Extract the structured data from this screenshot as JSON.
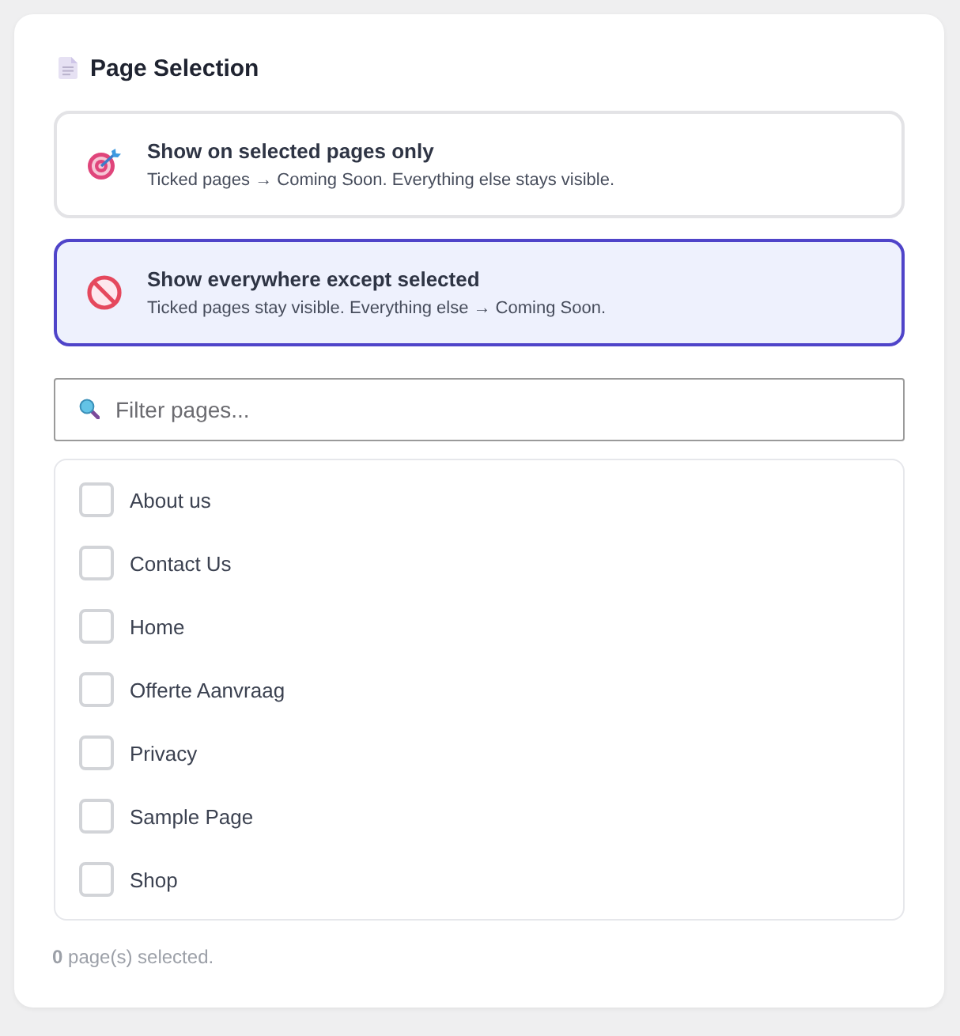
{
  "section": {
    "title": "Page Selection"
  },
  "modes": [
    {
      "kind": "include",
      "title": "Show on selected pages only",
      "description": "Ticked pages → Coming Soon. Everything else stays visible.",
      "selected": false
    },
    {
      "kind": "exclude",
      "title": "Show everywhere except selected",
      "description": "Ticked pages stay visible. Everything else → Coming Soon.",
      "selected": true
    }
  ],
  "filter": {
    "placeholder": "Filter pages..."
  },
  "pages": [
    {
      "label": "About us",
      "checked": false
    },
    {
      "label": "Contact Us",
      "checked": false
    },
    {
      "label": "Home",
      "checked": false
    },
    {
      "label": "Offerte Aanvraag",
      "checked": false
    },
    {
      "label": "Privacy",
      "checked": false
    },
    {
      "label": "Sample Page",
      "checked": false
    },
    {
      "label": "Shop",
      "checked": false
    }
  ],
  "footer": "**0** page(s) selected."
}
